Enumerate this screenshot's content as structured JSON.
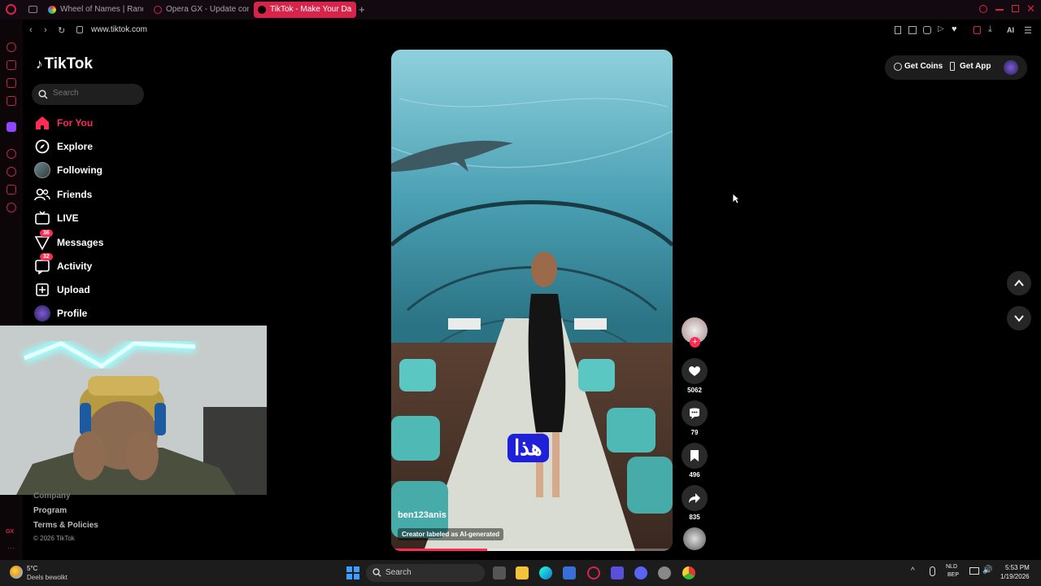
{
  "browser": {
    "tabs": [
      {
        "label": "Wheel of Names | Random",
        "active": false
      },
      {
        "label": "Opera GX - Update comp",
        "active": false
      },
      {
        "label": "TikTok - Make Your Da",
        "active": true
      }
    ],
    "url": "www.tiktok.com",
    "ai_label": "AI",
    "accent": "#d6244b"
  },
  "tiktok": {
    "logo": "TikTok",
    "search_placeholder": "Search",
    "nav": [
      {
        "label": "For You",
        "icon": "home-icon",
        "active": true
      },
      {
        "label": "Explore",
        "icon": "compass-icon",
        "active": false
      },
      {
        "label": "Following",
        "icon": "avatar-icon",
        "active": false
      },
      {
        "label": "Friends",
        "icon": "friends-icon",
        "active": false
      },
      {
        "label": "LIVE",
        "icon": "live-tv-icon",
        "active": false
      },
      {
        "label": "Messages",
        "icon": "message-icon",
        "active": false,
        "badge": "36"
      },
      {
        "label": "Activity",
        "icon": "activity-icon",
        "active": false,
        "badge": "32"
      },
      {
        "label": "Upload",
        "icon": "upload-icon",
        "active": false
      },
      {
        "label": "Profile",
        "icon": "profile-avatar",
        "active": false
      }
    ],
    "footer": [
      "Company",
      "Program",
      "Terms & Policies",
      "© 2026 TikTok"
    ],
    "get_coins": "Get Coins",
    "get_app": "Get App",
    "video": {
      "caption_overlay": "هذا",
      "author": "ben123anis",
      "ai_label": "Creator labeled as AI-generated",
      "progress": 0.34
    },
    "actions": {
      "likes": "5062",
      "comments": "79",
      "saves": "496",
      "shares": "835"
    }
  },
  "taskbar": {
    "weather_temp": "5°C",
    "weather_desc": "Deels bewolkt",
    "search_label": "Search",
    "lang": "NLD",
    "lang2": "BEP",
    "time": "5:53 PM",
    "date": "1/19/2026"
  }
}
